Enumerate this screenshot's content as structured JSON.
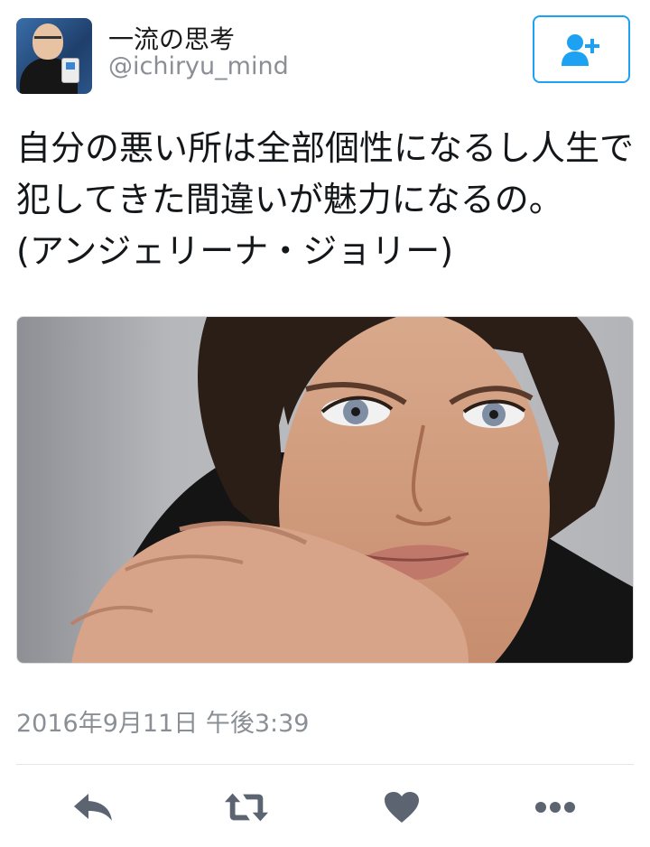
{
  "tweet": {
    "user": {
      "display_name": "一流の思考",
      "handle": "@ichiryu_mind",
      "avatar_icon": "profile-photo"
    },
    "follow_button_icon": "add-user-icon",
    "text_lines": [
      "自分の悪い所は全部個性になるし人生で",
      "犯してきた間違いが魅力になるの。",
      "(アンジェリーナ・ジョリー)"
    ],
    "media": {
      "type": "photo"
    },
    "timestamp": "2016年9月11日 午後3:39",
    "actions": [
      {
        "name": "reply",
        "icon": "reply-icon"
      },
      {
        "name": "retweet",
        "icon": "retweet-icon"
      },
      {
        "name": "like",
        "icon": "heart-icon"
      },
      {
        "name": "more",
        "icon": "more-icon"
      }
    ]
  },
  "colors": {
    "accent": "#1da1f2",
    "text": "#14171a",
    "secondary_text": "#8a8f95",
    "action_icon": "#5b6470"
  }
}
